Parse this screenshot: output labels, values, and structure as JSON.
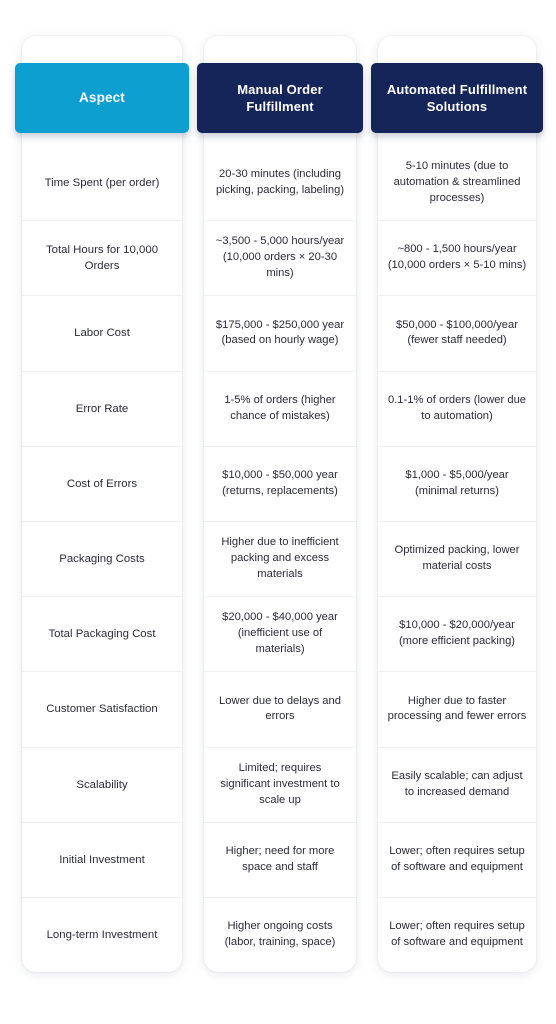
{
  "theme": {
    "accent_cyan": "#0d9fd0",
    "accent_navy": "#15255a",
    "page_background": "#ffffff",
    "text_color": "#2c2c38",
    "divider_color": "#eef0f3"
  },
  "table": {
    "headers": {
      "aspect": "Aspect",
      "manual": "Manual Order Fulfillment",
      "automated": "Automated Fulfillment Solutions"
    },
    "rows": [
      {
        "aspect": "Time Spent (per order)",
        "manual": "20-30 minutes (including picking, packing, labeling)",
        "automated": "5-10 minutes (due to automation & streamlined processes)"
      },
      {
        "aspect": "Total Hours for 10,000 Orders",
        "manual": "~3,500 - 5,000 hours/year (10,000 orders × 20-30 mins)",
        "automated": "~800 - 1,500 hours/year (10,000 orders × 5-10 mins)"
      },
      {
        "aspect": "Labor Cost",
        "manual": "$175,000 - $250,000 year (based on hourly wage)",
        "automated": "$50,000 - $100,000/year (fewer staff needed)"
      },
      {
        "aspect": "Error Rate",
        "manual": "1-5% of orders (higher chance of mistakes)",
        "automated": "0.1-1% of orders (lower due to automation)"
      },
      {
        "aspect": "Cost of Errors",
        "manual": "$10,000 - $50,000 year (returns, replacements)",
        "automated": "$1,000 - $5,000/year (minimal returns)"
      },
      {
        "aspect": "Packaging Costs",
        "manual": "Higher due to inefficient packing and excess materials",
        "automated": "Optimized packing, lower material costs"
      },
      {
        "aspect": "Total Packaging Cost",
        "manual": "$20,000 - $40,000 year (inefficient use of materials)",
        "automated": "$10,000 - $20,000/year (more efficient packing)"
      },
      {
        "aspect": "Customer Satisfaction",
        "manual": "Lower due to delays and errors",
        "automated": "Higher due to faster processing and fewer errors"
      },
      {
        "aspect": "Scalability",
        "manual": "Limited; requires significant investment to scale up",
        "automated": "Easily scalable; can adjust to increased demand"
      },
      {
        "aspect": "Initial Investment",
        "manual": "Higher; need for more space and staff",
        "automated": "Lower; often requires setup of software and equipment"
      },
      {
        "aspect": "Long-term Investment",
        "manual": "Higher ongoing costs (labor, training, space)",
        "automated": "Lower; often requires setup of software and equipment"
      }
    ]
  }
}
